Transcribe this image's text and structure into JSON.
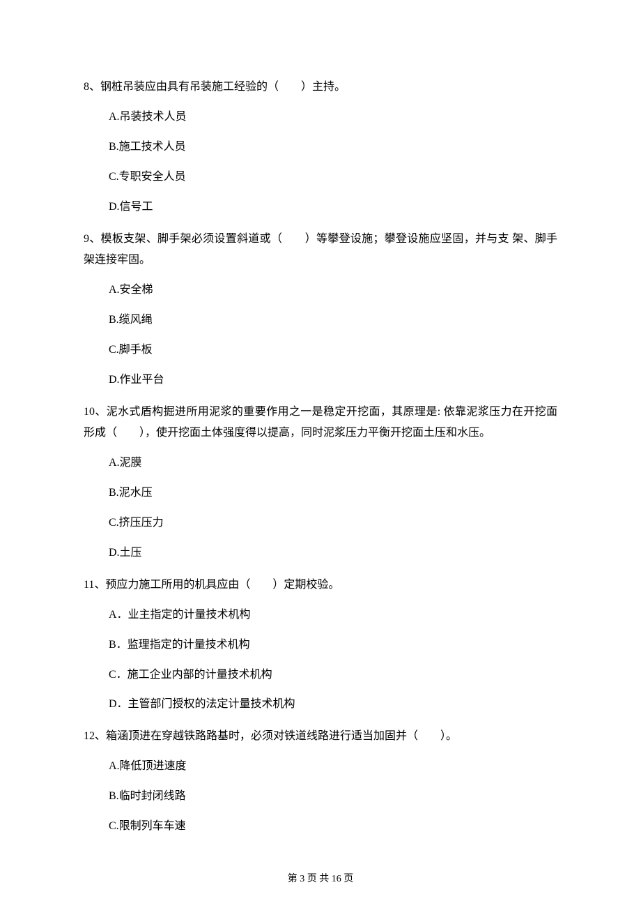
{
  "questions": [
    {
      "text": "8、钢桩吊装应由具有吊装施工经验的（　　）主持。",
      "options": [
        "A.吊装技术人员",
        "B.施工技术人员",
        "C.专职安全人员",
        "D.信号工"
      ]
    },
    {
      "text": "9、模板支架、脚手架必须设置斜道或（　　）等攀登设施；攀登设施应坚固，并与支 架、脚手架连接牢固。",
      "options": [
        "A.安全梯",
        "B.缆风绳",
        "C.脚手板",
        "D.作业平台"
      ]
    },
    {
      "text": "10、泥水式盾构掘进所用泥浆的重要作用之一是稳定开挖面，其原理是: 依靠泥浆压力在开挖面形成（　　），使开挖面土体强度得以提高，同时泥浆压力平衡开挖面土压和水压。",
      "options": [
        "A.泥膜",
        "B.泥水压",
        "C.挤压压力",
        "D.土压"
      ]
    },
    {
      "text": "11、预应力施工所用的机具应由（　　）定期校验。",
      "options": [
        "A．业主指定的计量技术机构",
        "B．监理指定的计量技术机构",
        "C．施工企业内部的计量技术机构",
        "D．主管部门授权的法定计量技术机构"
      ]
    },
    {
      "text": "12、箱涵顶进在穿越铁路路基时，必须对铁道线路进行适当加固并（　　）。",
      "options": [
        "A.降低顶进速度",
        "B.临时封闭线路",
        "C.限制列车车速"
      ]
    }
  ],
  "footer": "第 3 页 共 16 页"
}
